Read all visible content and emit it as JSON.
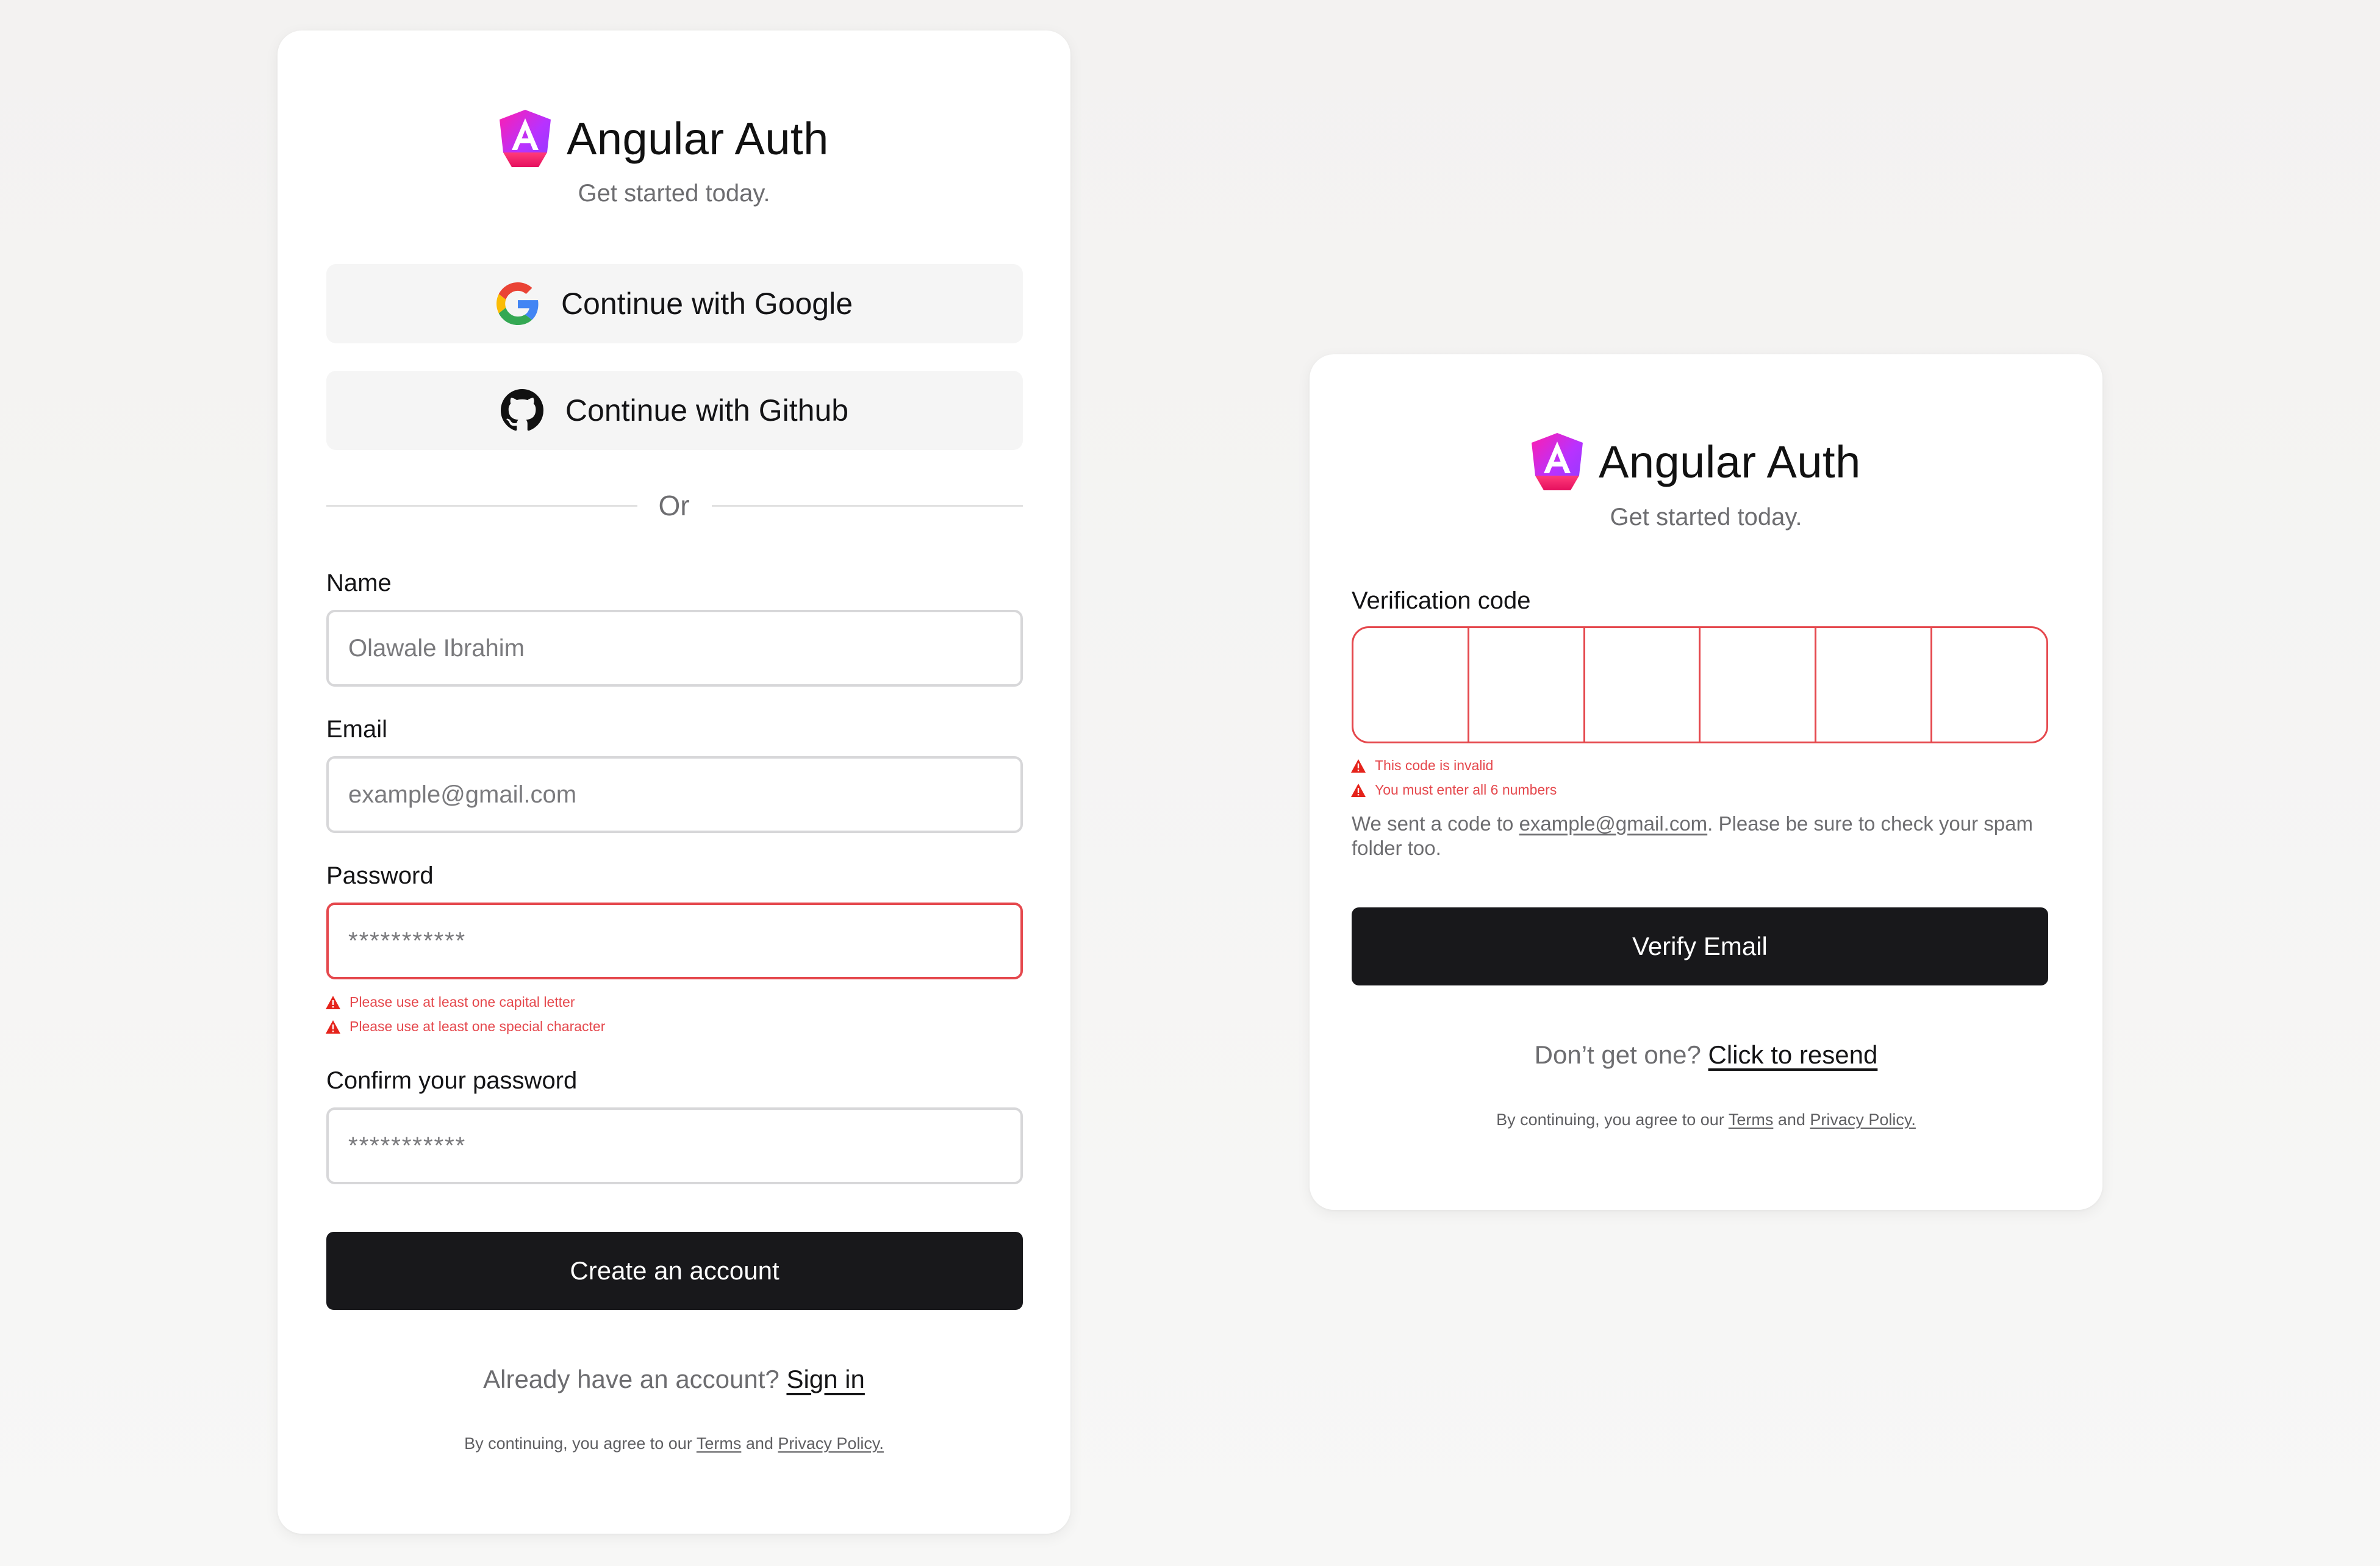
{
  "brand": {
    "title": "Angular Auth",
    "subtitle": "Get started today."
  },
  "colors": {
    "primary": "#18181b",
    "error": "#e5484d",
    "logo_start": "#ff1dad",
    "logo_end": "#8d3cff"
  },
  "signup": {
    "google_label": "Continue with Google",
    "github_label": "Continue with Github",
    "divider": "Or",
    "name": {
      "label": "Name",
      "placeholder": "Olawale Ibrahim"
    },
    "email": {
      "label": "Email",
      "placeholder": "example@gmail.com"
    },
    "password": {
      "label": "Password",
      "placeholder": "***********",
      "errors": [
        "Please use at least one capital letter",
        "Please use at least one special character"
      ]
    },
    "confirm": {
      "label": "Confirm your password",
      "placeholder": "***********"
    },
    "submit_label": "Create an account",
    "signin_prompt": "Already have an account?",
    "signin_link": "Sign in"
  },
  "verify": {
    "code_label": "Verification code",
    "errors": [
      "This code is invalid",
      "You must enter all 6 numbers"
    ],
    "info_prefix": "We sent a code to ",
    "info_email": "example@gmail.com",
    "info_suffix": ". Please be sure to check your spam folder too.",
    "submit_label": "Verify Email",
    "resend_prompt": "Don’t get one?",
    "resend_link": "Click to resend"
  },
  "legal": {
    "prefix": "By continuing, you agree to our ",
    "terms": "Terms",
    "and": " and ",
    "privacy": "Privacy Policy."
  }
}
